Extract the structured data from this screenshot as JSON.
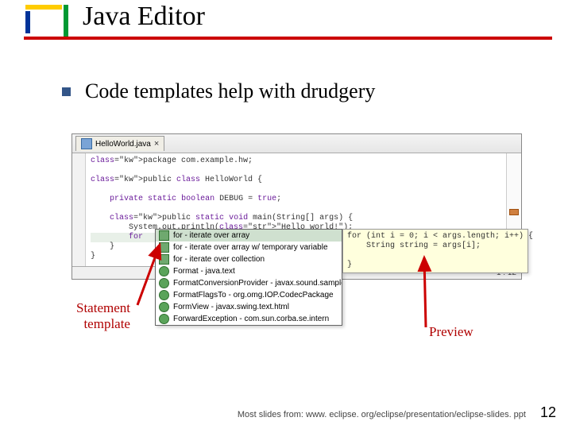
{
  "title": "Java Editor",
  "bullet": "Code templates help with drudgery",
  "editor": {
    "tab_label": "HelloWorld.java",
    "status": "1 : 12",
    "code_lines": [
      "package com.example.hw;",
      "",
      "public class HelloWorld {",
      "",
      "    private static boolean DEBUG = true;",
      "",
      "    public static void main(String[] args) {",
      "        System.out.println(\"Hello world!\");",
      "        for",
      "    }",
      "}"
    ]
  },
  "popup": {
    "items": [
      {
        "icon": "tpl",
        "label": "for - iterate over array",
        "selected": true
      },
      {
        "icon": "tpl",
        "label": "for - iterate over array w/ temporary variable",
        "selected": false
      },
      {
        "icon": "tpl",
        "label": "for - iterate over collection",
        "selected": false
      },
      {
        "icon": "cls",
        "label": "Format - java.text",
        "selected": false
      },
      {
        "icon": "cls",
        "label": "FormatConversionProvider - javax.sound.sampled.sp",
        "selected": false
      },
      {
        "icon": "cls",
        "label": "FormatFlagsTo - org.omg.IOP.CodecPackage",
        "selected": false
      },
      {
        "icon": "cls",
        "label": "FormView - javax.swing.text.html",
        "selected": false
      },
      {
        "icon": "cls",
        "label": "ForwardException - com.sun.corba.se.intern",
        "selected": false
      }
    ],
    "preview": "for (int i = 0; i < args.length; i++) {\n    String string = args[i];\n    \n}"
  },
  "callouts": {
    "statement": "Statement\ntemplate",
    "preview": "Preview"
  },
  "footer": {
    "credit": "Most slides from: www. eclipse. org/eclipse/presentation/eclipse-slides. ppt",
    "page": "12"
  }
}
